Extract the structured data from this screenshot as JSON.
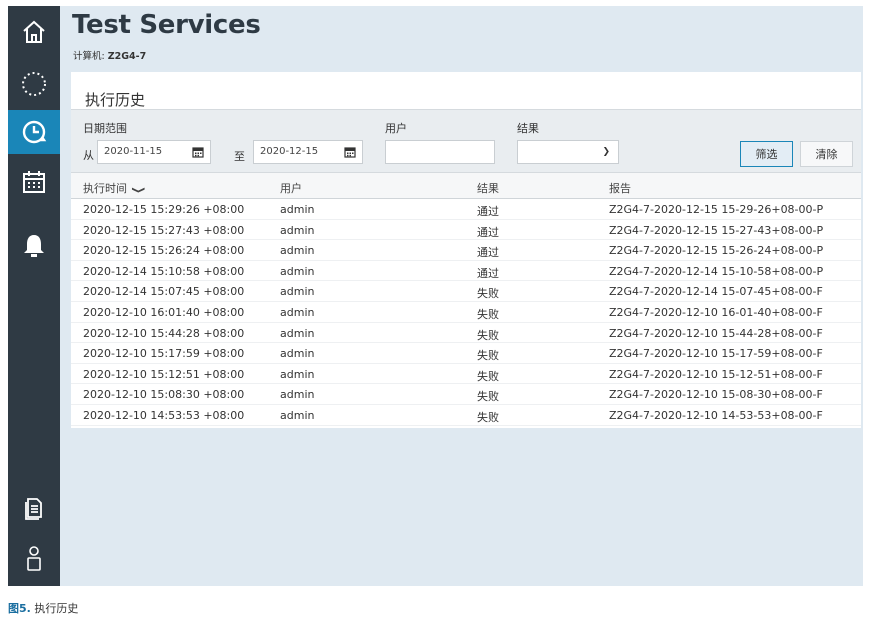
{
  "app": {
    "title": "Test Services",
    "machine_label": "计算机: ",
    "machine_value": "Z2G4-7"
  },
  "sidebar": {
    "items": [
      {
        "icon": "home-icon"
      },
      {
        "icon": "loading-ring-icon"
      },
      {
        "icon": "history-clock-icon",
        "active": true
      },
      {
        "icon": "calendar-icon"
      },
      {
        "icon": "bell-icon"
      },
      {
        "icon": "document-icon"
      },
      {
        "icon": "user-icon"
      }
    ]
  },
  "panel": {
    "title": "执行历史"
  },
  "filters": {
    "date_range_label": "日期范围",
    "from_label": "从",
    "from_value": "2020-11-15",
    "to_label": "至",
    "to_value": "2020-12-15",
    "user_label": "用户",
    "user_value": "",
    "result_label": "结果",
    "result_value": "",
    "filter_button": "筛选",
    "clear_button": "清除"
  },
  "table": {
    "columns": [
      "执行时间",
      "用户",
      "结果",
      "报告"
    ],
    "rows": [
      [
        "2020-12-15 15:29:26 +08:00",
        "admin",
        "通过",
        "Z2G4-7-2020-12-15 15-29-26+08-00-P"
      ],
      [
        "2020-12-15 15:27:43 +08:00",
        "admin",
        "通过",
        "Z2G4-7-2020-12-15 15-27-43+08-00-P"
      ],
      [
        "2020-12-15 15:26:24 +08:00",
        "admin",
        "通过",
        "Z2G4-7-2020-12-15 15-26-24+08-00-P"
      ],
      [
        "2020-12-14 15:10:58 +08:00",
        "admin",
        "通过",
        "Z2G4-7-2020-12-14 15-10-58+08-00-P"
      ],
      [
        "2020-12-14 15:07:45 +08:00",
        "admin",
        "失败",
        "Z2G4-7-2020-12-14 15-07-45+08-00-F"
      ],
      [
        "2020-12-10 16:01:40 +08:00",
        "admin",
        "失败",
        "Z2G4-7-2020-12-10 16-01-40+08-00-F"
      ],
      [
        "2020-12-10 15:44:28 +08:00",
        "admin",
        "失败",
        "Z2G4-7-2020-12-10 15-44-28+08-00-F"
      ],
      [
        "2020-12-10 15:17:59 +08:00",
        "admin",
        "失败",
        "Z2G4-7-2020-12-10 15-17-59+08-00-F"
      ],
      [
        "2020-12-10 15:12:51 +08:00",
        "admin",
        "失败",
        "Z2G4-7-2020-12-10 15-12-51+08-00-F"
      ],
      [
        "2020-12-10 15:08:30 +08:00",
        "admin",
        "失败",
        "Z2G4-7-2020-12-10 15-08-30+08-00-F"
      ],
      [
        "2020-12-10 14:53:53 +08:00",
        "admin",
        "失败",
        "Z2G4-7-2020-12-10 14-53-53+08-00-F"
      ]
    ]
  },
  "caption": {
    "label": "图5.",
    "text": " 执行历史"
  },
  "colors": {
    "sidebar": "#2f3a44",
    "active": "#1a86b8",
    "background": "#dfe9f1"
  }
}
